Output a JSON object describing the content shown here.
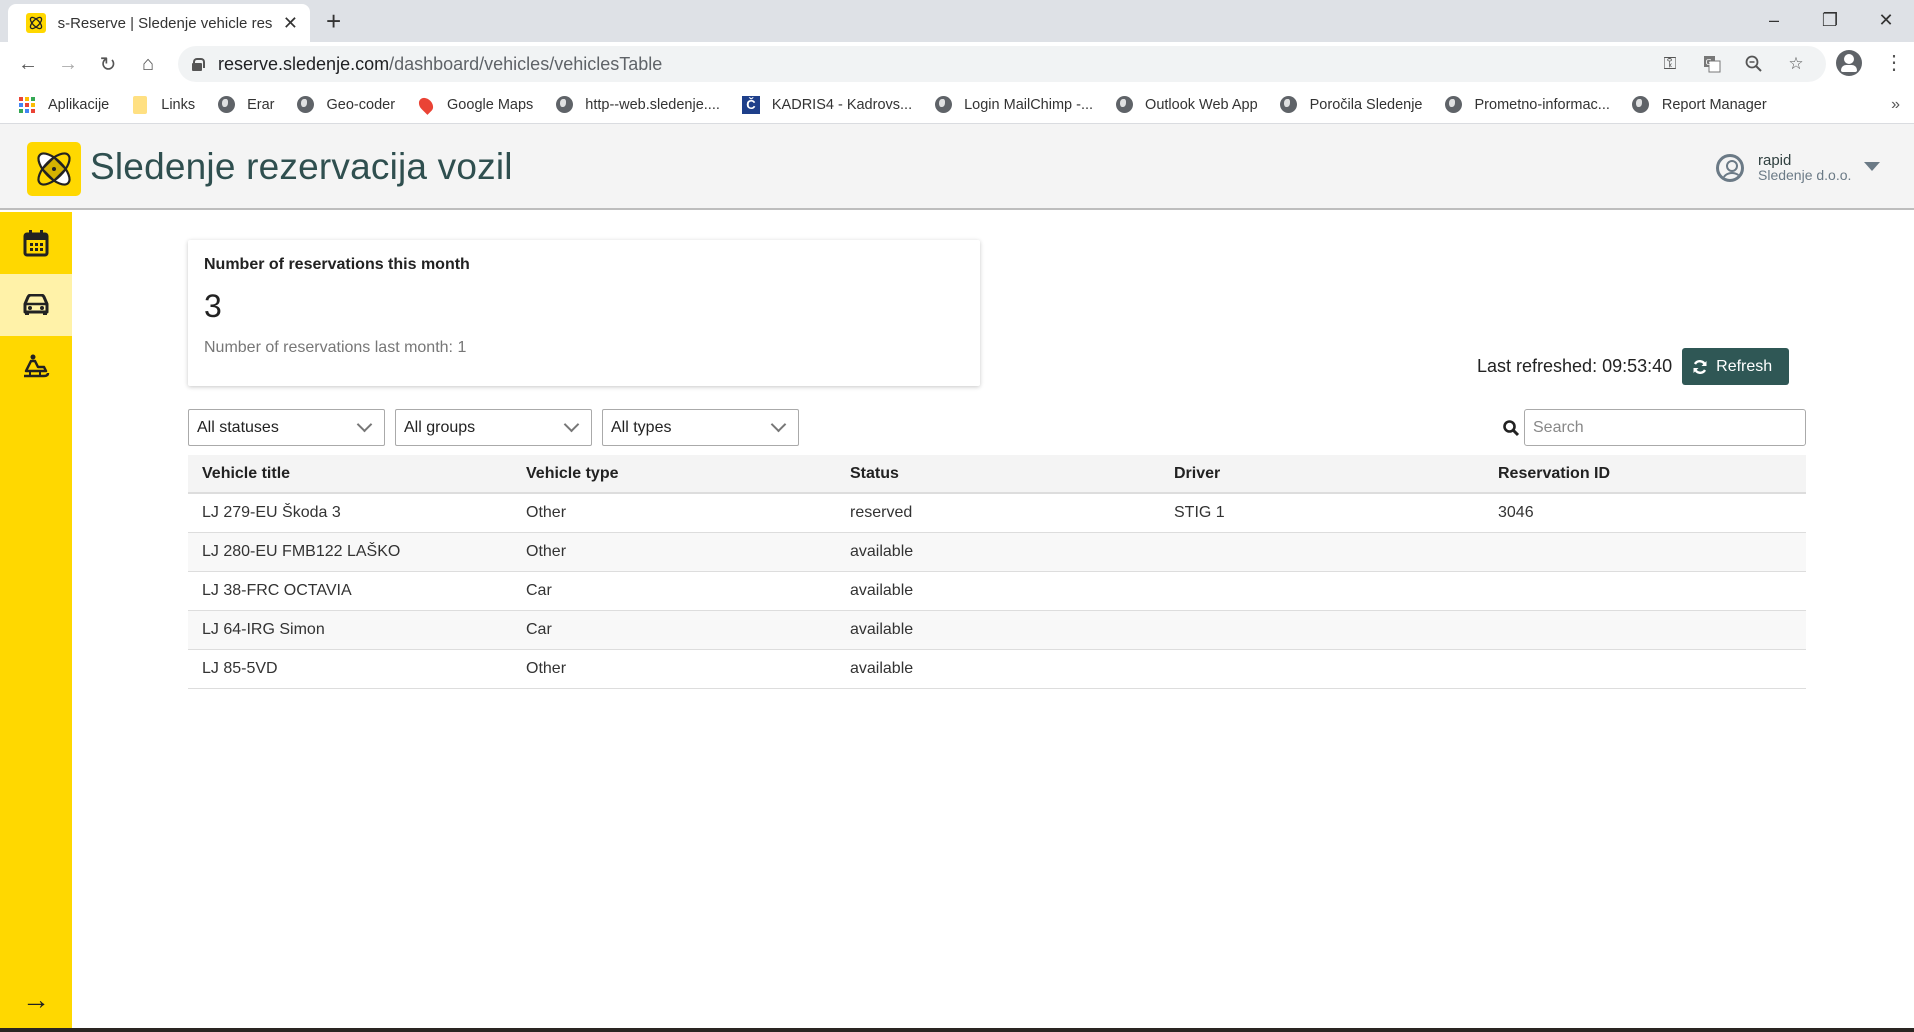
{
  "browser": {
    "tab_title": "s-Reserve | Sledenje vehicle reser",
    "url_host": "reserve.sledenje.com",
    "url_path": "/dashboard/vehicles/vehiclesTable",
    "bookmarks": [
      {
        "label": "Aplikacije",
        "icon": "apps-grid-icon"
      },
      {
        "label": "Links",
        "icon": "folder-icon"
      },
      {
        "label": "Erar",
        "icon": "globe-icon"
      },
      {
        "label": "Geo-coder",
        "icon": "globe-icon"
      },
      {
        "label": "Google Maps",
        "icon": "maps-pin-icon"
      },
      {
        "label": "http--web.sledenje....",
        "icon": "globe-icon"
      },
      {
        "label": "KADRIS4 - Kadrovs...",
        "icon": "kadris-icon"
      },
      {
        "label": "Login  MailChimp -...",
        "icon": "globe-icon"
      },
      {
        "label": "Outlook Web App",
        "icon": "globe-icon"
      },
      {
        "label": "Poročila Sledenje",
        "icon": "globe-icon"
      },
      {
        "label": "Prometno-informac...",
        "icon": "globe-icon"
      },
      {
        "label": "Report Manager",
        "icon": "globe-icon"
      }
    ],
    "more_bookmarks": "»"
  },
  "app": {
    "title": "Sledenje rezervacija vozil",
    "user": {
      "name": "rapid",
      "org": "Sledenje d.o.o."
    },
    "sidebar": [
      {
        "name": "calendar",
        "icon": "calendar-icon",
        "active": false
      },
      {
        "name": "vehicles",
        "icon": "car-icon",
        "active": true
      },
      {
        "name": "drivers",
        "icon": "snowmobile-icon",
        "active": false
      }
    ],
    "sidebar_expand": "→"
  },
  "stats": {
    "title": "Number of reservations this month",
    "value": "3",
    "subtitle": "Number of reservations last month: 1"
  },
  "refresh": {
    "last_refreshed": "Last refreshed: 09:53:40",
    "button_label": "Refresh"
  },
  "filters": {
    "status": "All statuses",
    "group": "All groups",
    "type": "All types"
  },
  "search": {
    "placeholder": "Search",
    "value": ""
  },
  "table": {
    "columns": [
      "Vehicle title",
      "Vehicle type",
      "Status",
      "Driver",
      "Reservation ID"
    ],
    "rows": [
      {
        "title": "LJ 279-EU Škoda 3",
        "type": "Other",
        "status": "reserved",
        "driver": "STIG 1",
        "reservation_id": "3046"
      },
      {
        "title": "LJ 280-EU FMB122 LAŠKO",
        "type": "Other",
        "status": "available",
        "driver": "",
        "reservation_id": ""
      },
      {
        "title": "LJ 38-FRC OCTAVIA",
        "type": "Car",
        "status": "available",
        "driver": "",
        "reservation_id": ""
      },
      {
        "title": "LJ 64-IRG Simon",
        "type": "Car",
        "status": "available",
        "driver": "",
        "reservation_id": ""
      },
      {
        "title": "LJ 85-5VD",
        "type": "Other",
        "status": "available",
        "driver": "",
        "reservation_id": ""
      }
    ]
  },
  "colors": {
    "brand_yellow": "#ffd800",
    "sidebar_active": "#fff2a8",
    "title_color": "#2f4f4f",
    "refresh_button": "#2f5755",
    "status_reserved": "#d32f2f",
    "status_available": "#2e7d32"
  }
}
